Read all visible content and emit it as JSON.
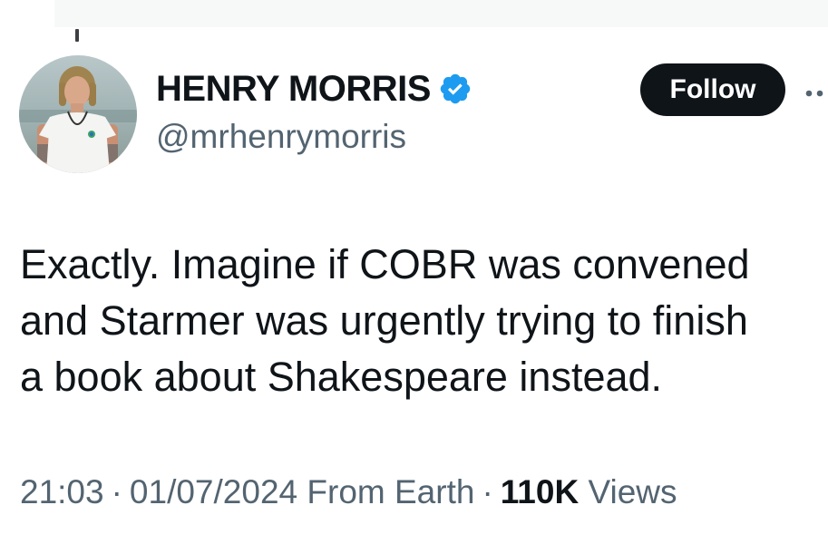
{
  "tweet": {
    "author": {
      "display_name": "HENRY MORRIS",
      "handle": "@mrhenrymorris",
      "verified": true,
      "verified_badge_color": "#1d9bf0"
    },
    "follow_label": "Follow",
    "text": "Exactly. Imagine if COBR was convened\nand Starmer was urgently trying to finish\na book about Shakespeare instead.",
    "time": "21:03",
    "date": "01/07/2024",
    "source": "From Earth",
    "separator": "·",
    "views_count": "110K",
    "views_label": "Views"
  },
  "colors": {
    "text_primary": "#0f1419",
    "text_secondary": "#536471",
    "follow_bg": "#0f1419",
    "follow_fg": "#ffffff"
  },
  "icons": {
    "verified": "verified-badge-icon",
    "more": "more-horizontal-icon",
    "thread": "thread-connector"
  }
}
